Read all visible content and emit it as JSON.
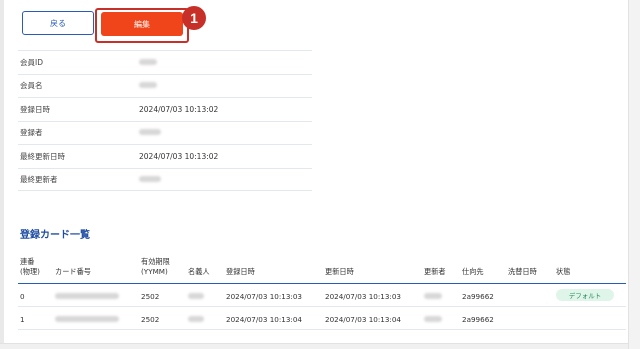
{
  "toolbar": {
    "back_label": "戻る",
    "edit_label": "編集",
    "step_number": "1"
  },
  "member_info": {
    "rows": [
      {
        "label": "会員ID",
        "value": ""
      },
      {
        "label": "会員名",
        "value": ""
      },
      {
        "label": "登録日時",
        "value": "2024/07/03 10:13:02"
      },
      {
        "label": "登録者",
        "value": ""
      },
      {
        "label": "最終更新日時",
        "value": "2024/07/03 10:13:02"
      },
      {
        "label": "最終更新者",
        "value": ""
      }
    ]
  },
  "cards_section": {
    "title": "登録カード一覧",
    "headers": {
      "seq_line1": "連番",
      "seq_line2": "(物理)",
      "card_no": "カード番号",
      "expiry_line1": "有効期限",
      "expiry_line2": "(YYMM)",
      "holder": "名義人",
      "created": "登録日時",
      "updated": "更新日時",
      "updater": "更新者",
      "destination": "仕向先",
      "settle": "洗替日時",
      "status": "状態"
    },
    "rows": [
      {
        "seq": "0",
        "expiry": "2502",
        "created": "2024/07/03 10:13:03",
        "updated": "2024/07/03 10:13:03",
        "destination": "2a99662",
        "status": "デフォルト"
      },
      {
        "seq": "1",
        "expiry": "2502",
        "created": "2024/07/03 10:13:04",
        "updated": "2024/07/03 10:13:04",
        "destination": "2a99662",
        "status": ""
      }
    ]
  },
  "colors": {
    "primary": "#2a5bb8",
    "accent": "#f0441a",
    "highlight": "#c73028",
    "badge_bg": "#dff5ea"
  }
}
